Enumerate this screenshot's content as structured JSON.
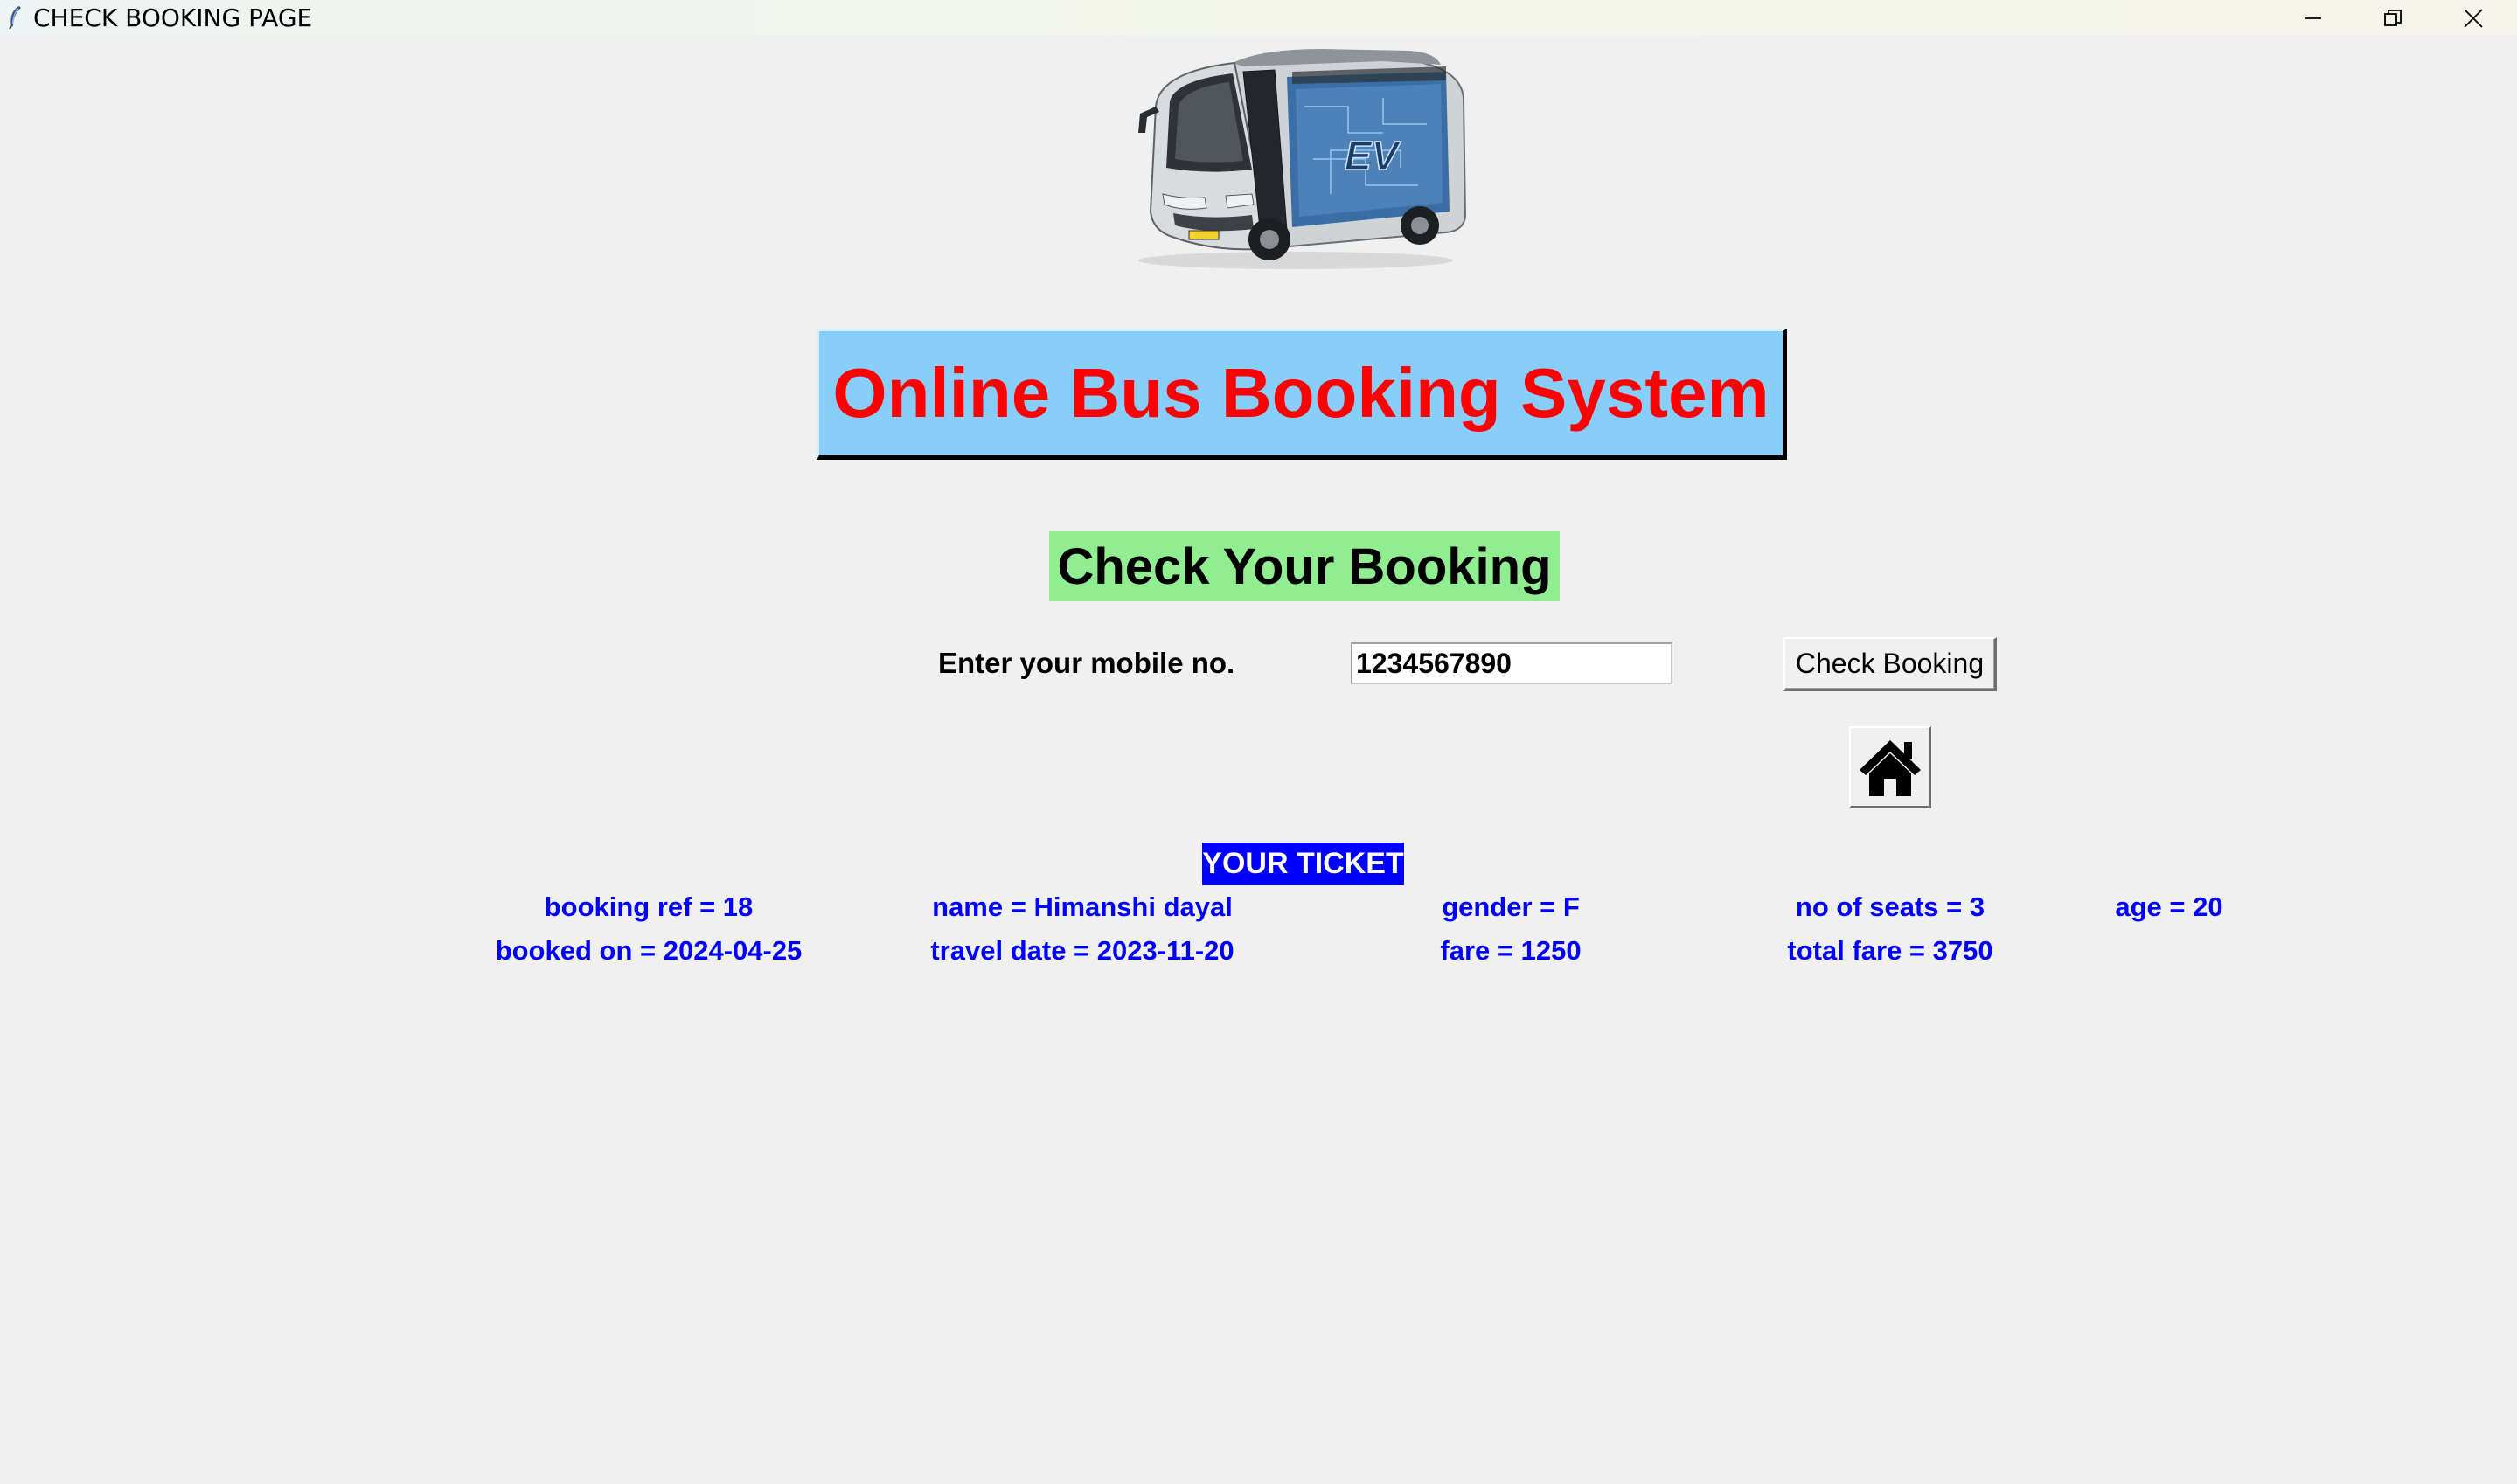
{
  "window": {
    "title": "CHECK BOOKING PAGE"
  },
  "header": {
    "system_title": "Online Bus Booking System",
    "bus_image": "electric-bus-image",
    "bus_badge": "EV"
  },
  "check": {
    "heading": "Check Your Booking",
    "mobile_label": "Enter your mobile no.",
    "mobile_value": "1234567890",
    "check_button_label": "Check Booking",
    "home_icon": "home-icon"
  },
  "ticket": {
    "heading": "YOUR TICKET",
    "row1": {
      "booking_ref": "booking ref = 18",
      "name": "name = Himanshi dayal",
      "gender": "gender = F",
      "seats": "no of seats = 3",
      "age": "age = 20"
    },
    "row2": {
      "booked_on": "booked on = 2024-04-25",
      "travel_date": "travel date = 2023-11-20",
      "fare": "fare = 1250",
      "total_fare": "total fare = 3750"
    }
  },
  "colors": {
    "title_bg": "#87cefa",
    "title_text": "#ff0000",
    "heading_bg": "#90ee90",
    "ticket_blue": "#0000ff",
    "window_bg": "#f0f0f0"
  }
}
